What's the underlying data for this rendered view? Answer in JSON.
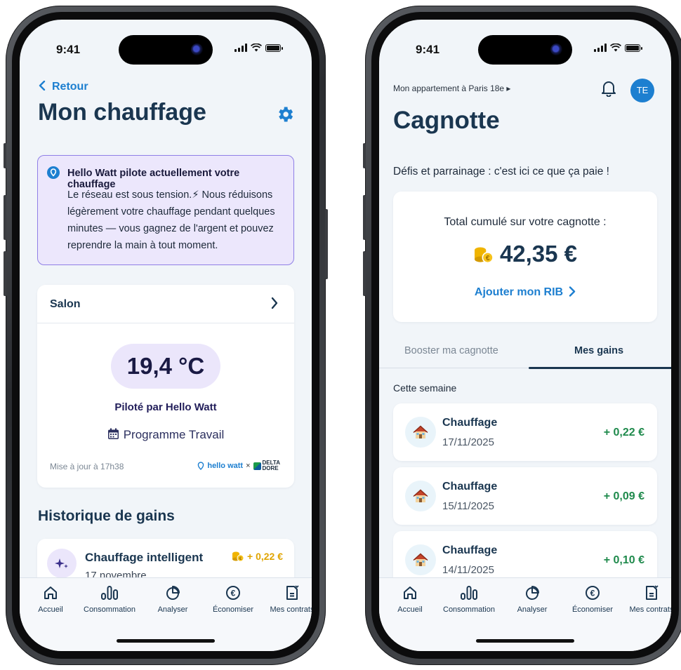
{
  "status": {
    "time": "9:41"
  },
  "left_screen": {
    "back_label": "Retour",
    "title": "Mon chauffage",
    "alert": {
      "title": "Hello Watt pilote actuellement votre chauffage",
      "body": "Le réseau est sous tension.⚡ Nous réduisons légèrement votre chauffage pendant quelques minutes — vous gagnez de l'argent et pouvez reprendre la main à tout moment.",
      "accent": "#8f7fe6"
    },
    "room": {
      "name": "Salon",
      "temperature": "19,4 °C",
      "pilot_label": "Piloté par Hello Watt",
      "program_label": "Programme Travail",
      "updated_label": "Mise à jour à 17h38",
      "brand_hello": "hello watt",
      "brand_sep": "×",
      "brand_delta_1": "DELTA",
      "brand_delta_2": "DORE"
    },
    "history": {
      "title": "Historique de gains",
      "items": [
        {
          "title": "Chauffage intelligent",
          "date": "17 novembre",
          "amount": "+ 0,22 €"
        }
      ]
    }
  },
  "right_screen": {
    "location": "Mon appartement à Paris 18e ▸",
    "avatar": "TE",
    "title": "Cagnotte",
    "subtitle": "Défis et parrainage : c'est ici ce que ça paie !",
    "total_label": "Total cumulé sur votre cagnotte :",
    "total_amount": "42,35 €",
    "rib_label": "Ajouter mon RIB",
    "tabs": [
      {
        "label": "Booster ma cagnotte",
        "active": false
      },
      {
        "label": "Mes gains",
        "active": true
      }
    ],
    "week_label": "Cette semaine",
    "gains": [
      {
        "title": "Chauffage",
        "date": "17/11/2025",
        "amount": "+ 0,22 €"
      },
      {
        "title": "Chauffage",
        "date": "15/11/2025",
        "amount": "+ 0,09 €"
      },
      {
        "title": "Chauffage",
        "date": "14/11/2025",
        "amount": "+ 0,10 €"
      }
    ]
  },
  "tabbar": [
    {
      "label": "Accueil",
      "icon": "home-icon"
    },
    {
      "label": "Consommation",
      "icon": "consumption-icon"
    },
    {
      "label": "Analyser",
      "icon": "analyze-icon"
    },
    {
      "label": "Économiser",
      "icon": "euro-icon"
    },
    {
      "label": "Mes contrats",
      "icon": "contracts-icon"
    }
  ],
  "colors": {
    "navy": "#1a3650",
    "accent_blue": "#1d7fd0",
    "gain_green": "#1f8a4c",
    "coin_gold": "#e0a400",
    "alert_bg": "#ece7fc"
  }
}
